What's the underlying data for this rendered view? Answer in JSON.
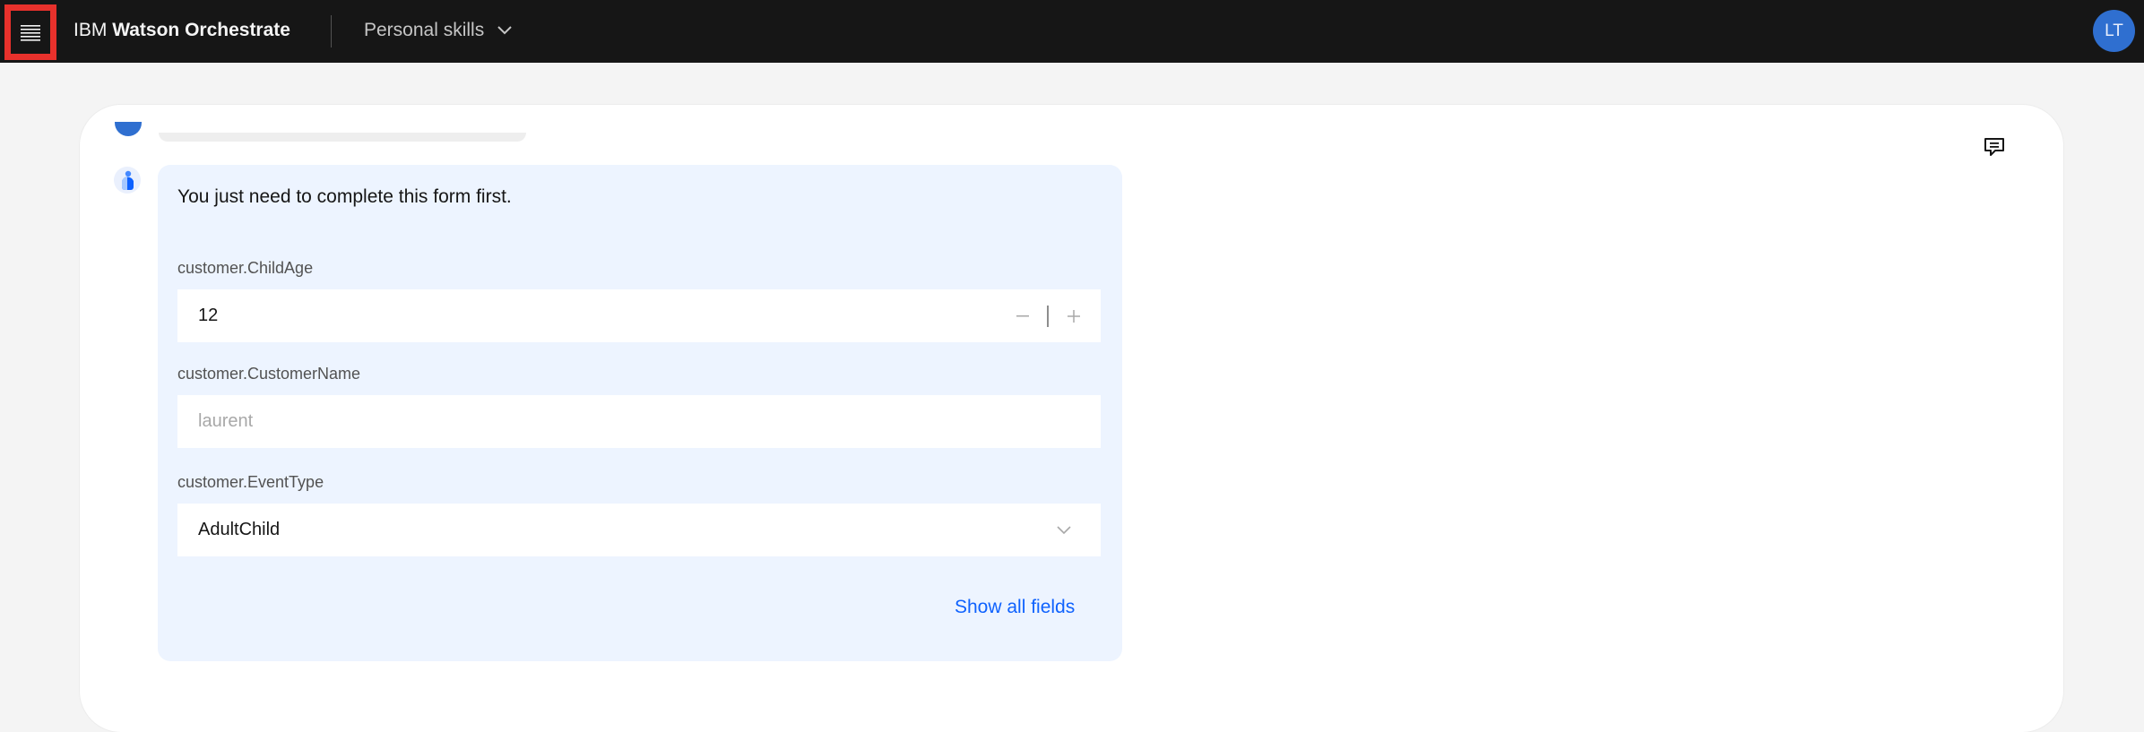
{
  "header": {
    "brand_prefix": "IBM",
    "brand_name": "Watson Orchestrate",
    "skills_switcher": "Personal skills",
    "user_initials": "LT",
    "icons": {
      "menu": "hamburger-menu-icon",
      "switcher": "chevron-down-icon",
      "feedback": "chat-feedback-icon"
    }
  },
  "colors": {
    "topbar": "#161616",
    "highlight": "#e8312c",
    "accent": "#0f62fe",
    "avatar": "#2f6fd0",
    "bubble": "#edf4ff"
  },
  "chat": {
    "message": "You just need to complete this form first.",
    "form": {
      "child_age": {
        "label": "customer.ChildAge",
        "value": "12"
      },
      "customer_name": {
        "label": "customer.CustomerName",
        "placeholder": "laurent"
      },
      "event_type": {
        "label": "customer.EventType",
        "selected": "AdultChild"
      }
    },
    "show_all_fields": "Show all fields"
  }
}
